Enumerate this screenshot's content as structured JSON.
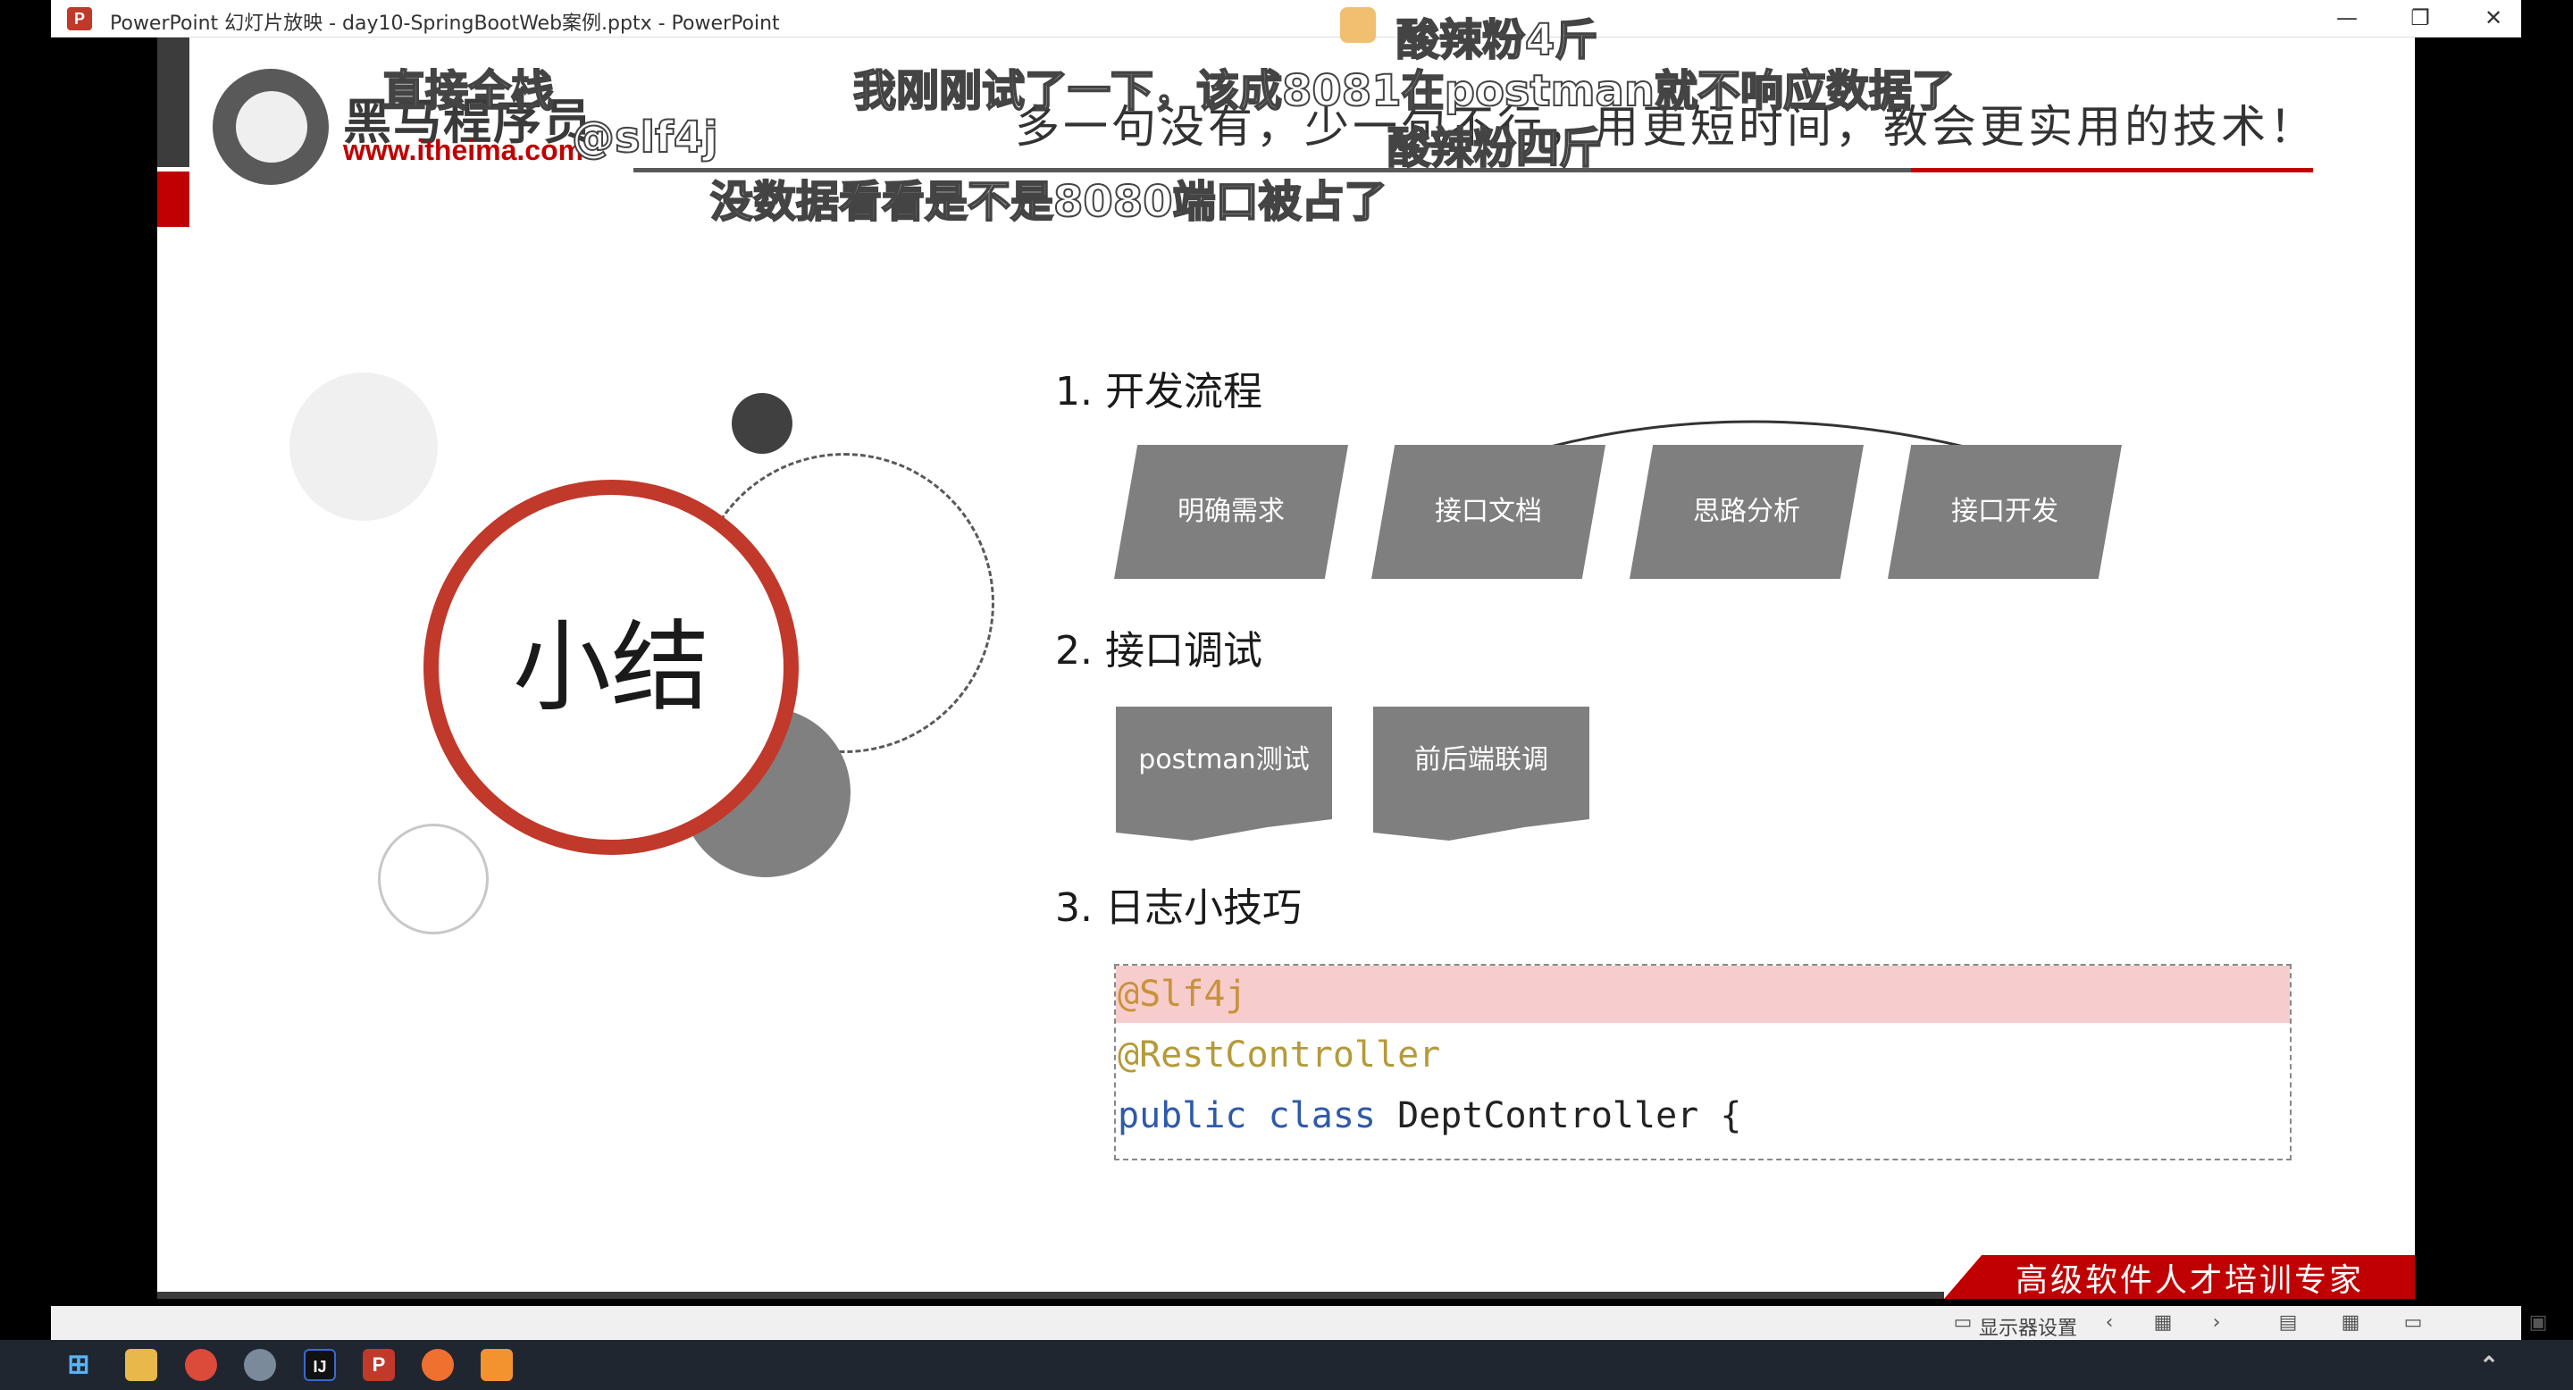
{
  "window": {
    "app_icon": "P",
    "title": "PowerPoint 幻灯片放映  -  day10-SpringBootWeb案例.pptx - PowerPoint",
    "min": "—",
    "restore": "❐",
    "close": "✕"
  },
  "slide": {
    "logo_main": "黑马程序员",
    "logo_url": "www.itheima.com",
    "slogan": "多一句没有，少一句不行，用更短时间，教会更实用的技术！",
    "summary": "小结",
    "sections": [
      {
        "title": "1.  开发流程",
        "steps": [
          "明确需求",
          "接口文档",
          "思路分析",
          "接口开发"
        ]
      },
      {
        "title": "2.  接口调试",
        "items": [
          "postman测试",
          "前后端联调"
        ]
      },
      {
        "title": "3.  日志小技巧"
      }
    ],
    "code": {
      "line1": "@Slf4j",
      "line2": "@RestController",
      "line3_kw1": "public",
      "line3_kw2": "class",
      "line3_rest": "DeptController {"
    },
    "footer": "高级软件人才培训专家"
  },
  "statusbar": {
    "display_settings": "显示器设置",
    "prev": "‹",
    "next": "›"
  },
  "danmaku": [
    "酸辣粉4斤",
    "直接全栈",
    "我刚刚试了一下，该成8081在postman就不响应数据了",
    "@slf4j",
    "酸辣粉四斤",
    "没数据看看是不是8080端口被占了"
  ],
  "colors": {
    "accent_red": "#c0392b",
    "gray": "#7f7f7f",
    "code_annotation": "#c8923a",
    "code_keyword": "#2f5aa8"
  }
}
